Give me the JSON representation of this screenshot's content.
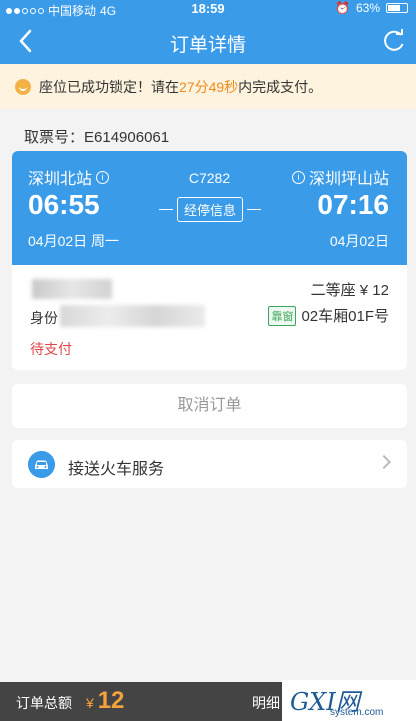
{
  "status_bar": {
    "carrier": "中国移动",
    "network": "4G",
    "time": "18:59",
    "battery": "63%"
  },
  "nav": {
    "title": "订单详情",
    "back_icon": "chevron-left-icon",
    "refresh_icon": "refresh-icon"
  },
  "notice": {
    "text_before": "座位已成功锁定！请在",
    "countdown": "27分49秒",
    "text_after": "内完成支付。"
  },
  "ticket": {
    "label": "取票号：",
    "number": "E614906061"
  },
  "train": {
    "from_station": "深圳北站",
    "to_station": "深圳坪山站",
    "train_code": "C7282",
    "stops_label": "经停信息",
    "depart_time": "06:55",
    "arrive_time": "07:16",
    "depart_date": "04月02日  周一",
    "arrive_date": "04月02日"
  },
  "passenger": {
    "id_label": "身份",
    "seat_type": "二等座 ¥ 12",
    "window_tag": "靠窗",
    "seat_position": "02车厢01F号",
    "status": "待支付"
  },
  "actions": {
    "cancel": "取消订单"
  },
  "service": {
    "label": "接送火车服务"
  },
  "bottom": {
    "total_label": "订单总额",
    "currency": "¥",
    "total": "12",
    "detail": "明细"
  },
  "watermark": {
    "brand": "GXI网",
    "site": "system.com"
  },
  "colors": {
    "primary": "#3a9be9",
    "accent": "#f08a1c",
    "danger": "#e0464b",
    "window_tag": "#3ca65c"
  }
}
